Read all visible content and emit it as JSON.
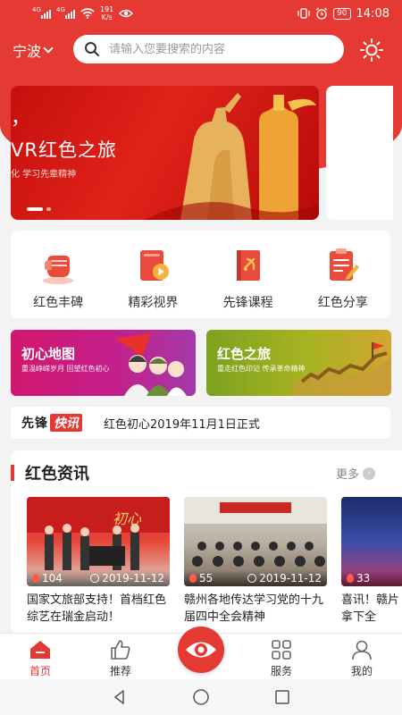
{
  "status_bar": {
    "speed_value": "191",
    "speed_unit": "K/s",
    "battery": "90",
    "time": "14:08"
  },
  "header": {
    "city": "宁波",
    "search_placeholder": "请输入您要搜索的内容"
  },
  "banner": {
    "comma": "，",
    "title": "VR红色之旅",
    "subtitle": "化 学习先辈精神"
  },
  "menu": [
    {
      "label": "红色丰碑",
      "icon": "fist-icon"
    },
    {
      "label": "精彩视界",
      "icon": "video-book-icon"
    },
    {
      "label": "先锋课程",
      "icon": "party-book-icon"
    },
    {
      "label": "红色分享",
      "icon": "edit-note-icon"
    }
  ],
  "promos": [
    {
      "title": "初心地图",
      "subtitle": "重温峥嵘岁月 回望红色初心"
    },
    {
      "title": "红色之旅",
      "subtitle": "重走红色印记 传承革命精神"
    }
  ],
  "ticker": {
    "logo_a": "先锋",
    "logo_b": "快讯",
    "text": "红色初心2019年11月1日正式"
  },
  "news": {
    "title": "红色资讯",
    "more": "更多",
    "items": [
      {
        "views": "104",
        "date": "2019-11-12",
        "caption": "国家文旅部支持！首档红色综艺在瑞金启动！"
      },
      {
        "views": "55",
        "date": "2019-11-12",
        "caption": "赣州各地传达学习党的十九届四中全会精神"
      },
      {
        "views": "33",
        "date": "",
        "caption": "喜讯！赣片拿下全"
      }
    ]
  },
  "bottom_nav": [
    {
      "label": "首页",
      "active": true
    },
    {
      "label": "推荐",
      "active": false
    },
    {
      "label": "服务",
      "active": false
    },
    {
      "label": "我的",
      "active": false
    }
  ],
  "colors": {
    "primary": "#e53a33",
    "background": "#f3f3f3"
  }
}
